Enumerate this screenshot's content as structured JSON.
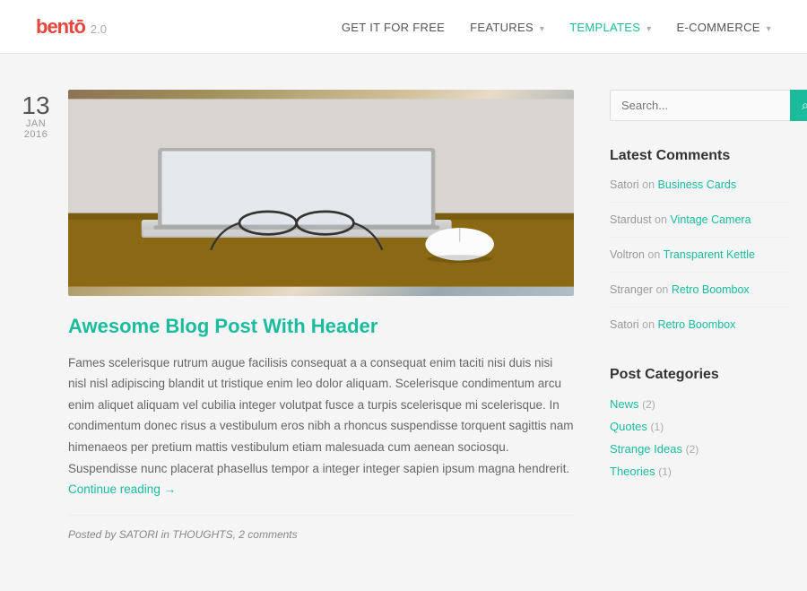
{
  "logo": {
    "name": "bentō",
    "version": "2.0"
  },
  "nav": {
    "links": [
      {
        "label": "GET IT FOR FREE",
        "active": false,
        "has_arrow": false
      },
      {
        "label": "FEATURES",
        "active": false,
        "has_arrow": true
      },
      {
        "label": "TEMPLATES",
        "active": true,
        "has_arrow": true
      },
      {
        "label": "E-COMMERCE",
        "active": false,
        "has_arrow": true
      }
    ]
  },
  "post": {
    "date": {
      "day": "13",
      "month": "JAN",
      "year": "2016"
    },
    "title": "Awesome Blog Post With Header",
    "body": "Fames scelerisque rutrum augue facilisis consequat a a consequat enim taciti nisi duis nisi nisl nisl adipiscing blandit ut tristique enim leo dolor aliquam. Scelerisque condimentum arcu enim aliquet aliquam vel cubilia integer volutpat fusce a turpis scelerisque mi scelerisque. In condimentum donec risus a vestibulum eros nibh a rhoncus suspendisse torquent sagittis nam himenaeos per pretium mattis vestibulum etiam malesuada cum aenean sociosqu. Suspendisse nunc placerat phasellus tempor a integer integer sapien ipsum magna hendrerit.",
    "read_more": "Continue reading →",
    "meta": "Posted by SATORI in THOUGHTS, 2 comments"
  },
  "sidebar": {
    "search": {
      "placeholder": "Search..."
    },
    "latest_comments": {
      "title": "Latest Comments",
      "items": [
        {
          "author": "Satori",
          "on_text": "on",
          "link_text": "Business Cards"
        },
        {
          "author": "Stardust",
          "on_text": "on",
          "link_text": "Vintage Camera"
        },
        {
          "author": "Voltron",
          "on_text": "on",
          "link_text": "Transparent Kettle"
        },
        {
          "author": "Stranger",
          "on_text": "on",
          "link_text": "Retro Boombox"
        },
        {
          "author": "Satori",
          "on_text": "on",
          "link_text": "Retro Boombox"
        }
      ]
    },
    "post_categories": {
      "title": "Post Categories",
      "items": [
        {
          "label": "News",
          "count": "(2)"
        },
        {
          "label": "Quotes",
          "count": "(1)"
        },
        {
          "label": "Strange Ideas",
          "count": "(2)"
        },
        {
          "label": "Theories",
          "count": "(1)"
        }
      ]
    }
  }
}
